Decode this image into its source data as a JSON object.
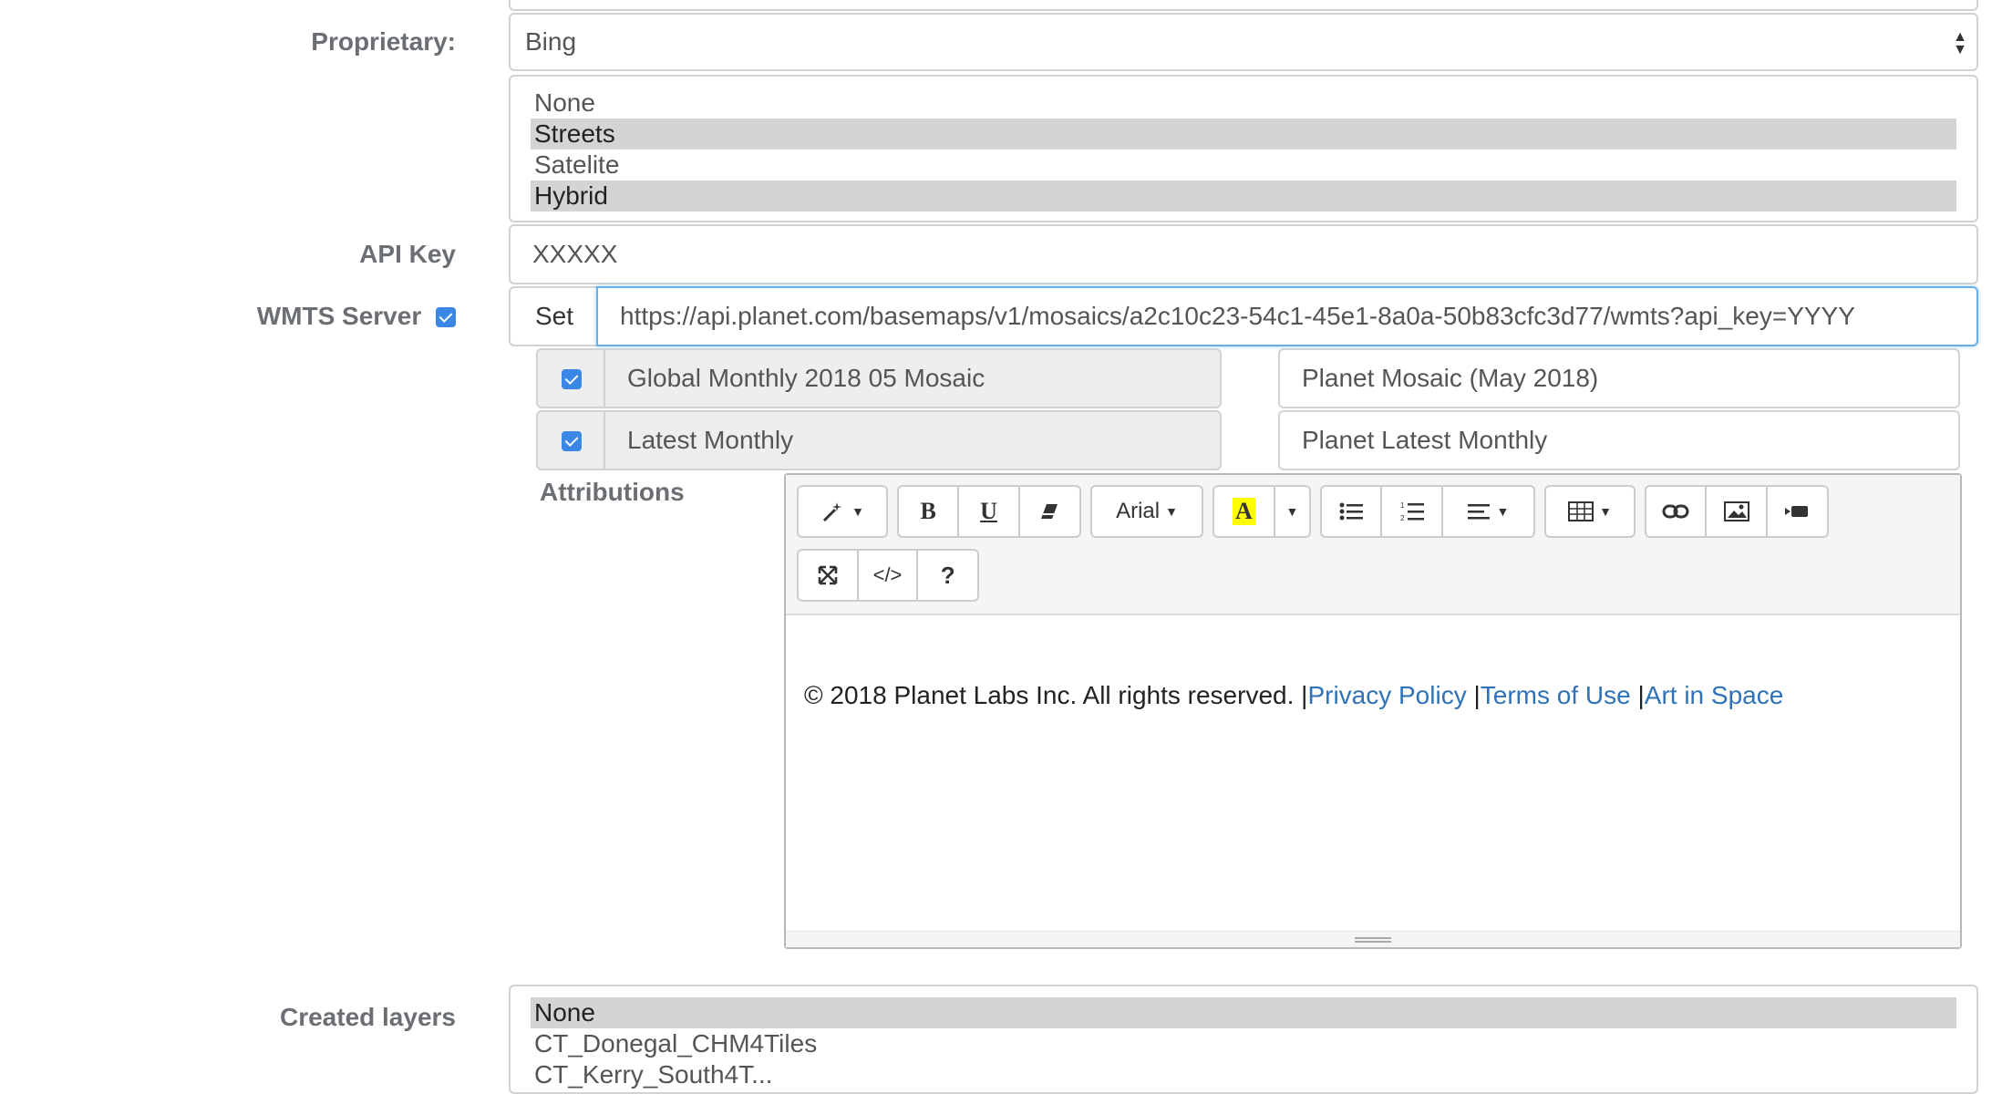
{
  "proprietary": {
    "label": "Proprietary:",
    "selected": "Bing",
    "options": [
      {
        "label": "None",
        "selected": false
      },
      {
        "label": "Streets",
        "selected": true
      },
      {
        "label": "Satelite",
        "selected": false
      },
      {
        "label": "Hybrid",
        "selected": true
      }
    ]
  },
  "api_key": {
    "label": "API Key",
    "value": "XXXXX"
  },
  "wmts": {
    "label": "WMTS Server",
    "checked": true,
    "set_label": "Set",
    "url": "https://api.planet.com/basemaps/v1/mosaics/a2c10c23-54c1-45e1-8a0a-50b83cfc3d77/wmts?api_key=YYYY",
    "layers": [
      {
        "name": "Global Monthly 2018 05 Mosaic",
        "title": "Planet Mosaic (May 2018)",
        "checked": true
      },
      {
        "name": "Latest Monthly",
        "title": "Planet Latest Monthly",
        "checked": true
      }
    ]
  },
  "attributions": {
    "label": "Attributions",
    "toolbar": {
      "font": "Arial",
      "icons": [
        "magic-wand-icon",
        "bold-icon",
        "underline-icon",
        "eraser-icon",
        "font-dropdown",
        "text-color-icon",
        "unordered-list-icon",
        "ordered-list-icon",
        "align-icon",
        "table-icon",
        "link-icon",
        "image-icon",
        "video-icon",
        "fullscreen-icon",
        "code-view-icon",
        "help-icon"
      ],
      "bold": "B",
      "underline": "U",
      "color_letter": "A",
      "code": "</>",
      "help": "?",
      "highlight_color": "#ffff00"
    },
    "text": "© 2018 Planet Labs Inc. All rights reserved. |",
    "links": [
      "Privacy Policy",
      "Terms of Use",
      "Art in Space"
    ],
    "separator": " |"
  },
  "created_layers": {
    "label": "Created layers",
    "options": [
      {
        "label": "None",
        "selected": true
      },
      {
        "label": "CT_Donegal_CHM4Tiles",
        "selected": false
      },
      {
        "label": "CT_Kerry_South4T...",
        "selected": false
      }
    ]
  },
  "colors": {
    "accent": "#3b87e6",
    "link": "#2f72b8",
    "label": "#6b6f73",
    "focus_border": "#66afe9"
  }
}
